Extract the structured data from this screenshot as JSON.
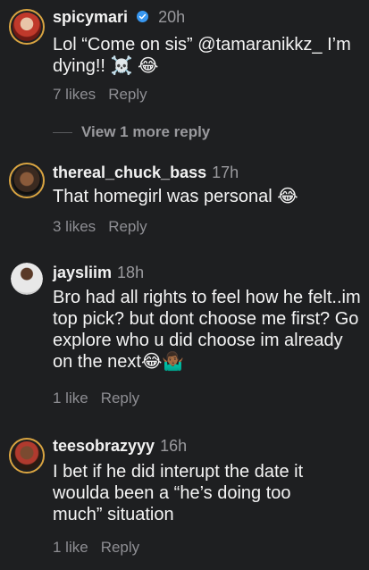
{
  "comments": [
    {
      "username": "spicymari",
      "time": "20h",
      "text": "Lol “Come on sis” @tamaranikkz_ I’m dying!! ☠️ 😂",
      "likes": "7 likes",
      "reply": "Reply",
      "view_more": "View 1 more reply"
    },
    {
      "username": "thereal_chuck_bass",
      "time": "17h",
      "text": "That homegirl was personal 😂",
      "likes": "3 likes",
      "reply": "Reply"
    },
    {
      "username": "jaysliim",
      "time": "18h",
      "text": "Bro had all rights to feel how he felt..im top pick? but dont choose me first? Go explore who u did choose im already on the next😂🤷🏾‍♂️",
      "likes": "1 like",
      "reply": "Reply"
    },
    {
      "username": "teesobrazyyy",
      "time": "16h",
      "text": "I bet if he did interupt the date it woulda been a “he’s doing too much” situation",
      "likes": "1 like",
      "reply": "Reply"
    }
  ],
  "colors": {
    "background": "#1e1f21",
    "verified": "#3897f0",
    "muted": "#8e8e93"
  }
}
